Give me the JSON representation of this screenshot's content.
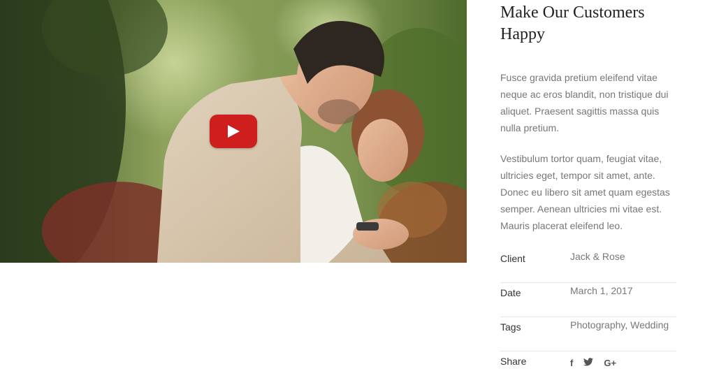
{
  "media": {
    "play_button_icon": "youtube-play-icon",
    "play_button_color": "#cf1e1e"
  },
  "project": {
    "title": "Make Our Customers Happy",
    "paragraphs": [
      "Fusce gravida pretium eleifend vitae neque ac eros blandit, non tristique dui aliquet. Praesent sagittis massa quis nulla pretium.",
      "Vestibulum tortor quam, feugiat vitae, ultricies eget, tempor sit amet, ante. Donec eu libero sit amet quam egestas semper. Aenean ultricies mi vitae est. Mauris placerat eleifend leo."
    ]
  },
  "meta": {
    "client": {
      "label": "Client",
      "value": "Jack & Rose"
    },
    "date": {
      "label": "Date",
      "value": "March 1, 2017"
    },
    "tags": {
      "label": "Tags",
      "items": [
        "Photography",
        "Wedding"
      ],
      "separator": ", "
    },
    "share": {
      "label": "Share",
      "icons": [
        {
          "name": "facebook-icon",
          "glyph": "f"
        },
        {
          "name": "twitter-icon",
          "glyph": "🐦"
        },
        {
          "name": "google-plus-icon",
          "glyph": "G+"
        }
      ]
    }
  }
}
